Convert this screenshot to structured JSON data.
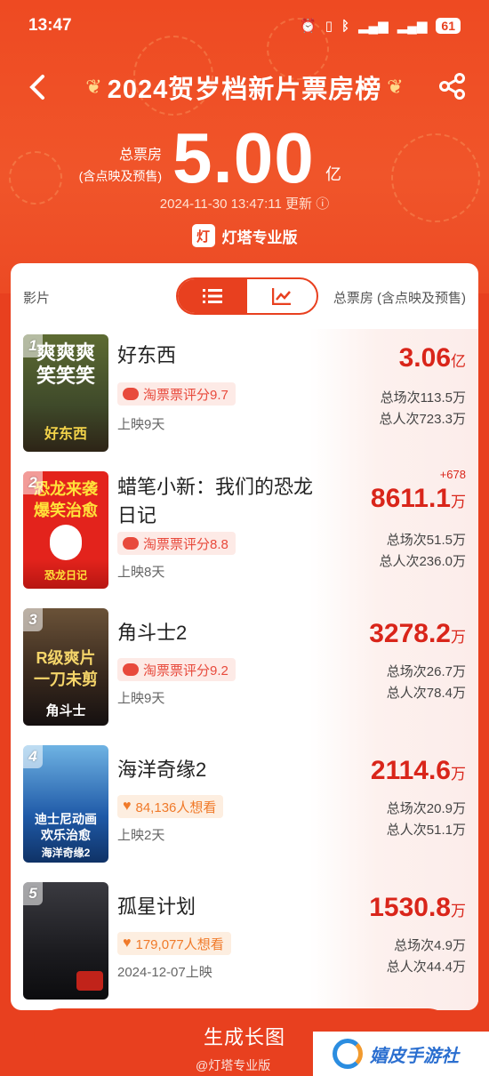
{
  "status": {
    "time": "13:47",
    "battery": "61"
  },
  "nav": {
    "title": "2024贺岁档新片票房榜"
  },
  "summary": {
    "label_line1": "总票房",
    "label_line2": "(含点映及预售)",
    "value": "5.00",
    "unit": "亿",
    "updated": "2024-11-30 13:47:11 更新 ⓘ"
  },
  "brand": {
    "logo_text": "灯",
    "label": "灯塔专业版"
  },
  "panel": {
    "col_film": "影片",
    "col_total": "总票房 (含点映及预售)",
    "view_active": "list-icon",
    "view_inactive": "chart-icon"
  },
  "films": [
    {
      "rank": "1",
      "name": "好东西",
      "badge": "淘票票评分9.7",
      "badge_type": "score",
      "release": "上映9天",
      "box": "3.06",
      "unit": "亿",
      "delta": "",
      "shows": "总场次113.5万",
      "viewers": "总人次723.3万",
      "poster_text": "爽 爽 爽\n笑 笑 笑",
      "poster_bg": "#3f4a2a"
    },
    {
      "rank": "2",
      "name": "蜡笔小新：我们的恐龙日记",
      "badge": "淘票票评分8.8",
      "badge_type": "score",
      "release": "上映8天",
      "box": "8611.1",
      "unit": "万",
      "delta": "+678",
      "shows": "总场次51.5万",
      "viewers": "总人次236.0万",
      "poster_text": "恐龙来袭\n爆笑治愈",
      "poster_bg": "#e3231c"
    },
    {
      "rank": "3",
      "name": "角斗士2",
      "badge": "淘票票评分9.2",
      "badge_type": "score",
      "release": "上映9天",
      "box": "3278.2",
      "unit": "万",
      "delta": "",
      "shows": "总场次26.7万",
      "viewers": "总人次78.4万",
      "poster_text": "R级爽片\n一刀未剪",
      "poster_bg": "#3a2a1e"
    },
    {
      "rank": "4",
      "name": "海洋奇缘2",
      "badge": "84,136人想看",
      "badge_type": "want",
      "release": "上映2天",
      "box": "2114.6",
      "unit": "万",
      "delta": "",
      "shows": "总场次20.9万",
      "viewers": "总人次51.1万",
      "poster_text": "迪士尼动画\n欢乐治愈",
      "poster_bg": "#1f5aa8"
    },
    {
      "rank": "5",
      "name": "孤星计划",
      "badge": "179,077人想看",
      "badge_type": "want",
      "release": "2024-12-07上映",
      "box": "1530.8",
      "unit": "万",
      "delta": "",
      "shows": "总场次4.9万",
      "viewers": "总人次44.4万",
      "poster_text": "",
      "poster_bg": "#1b1b1f"
    }
  ],
  "footer": {
    "button": "生成长图",
    "watermark": "@灯塔专业版",
    "corner_brand": "嬉皮手游社"
  },
  "colors": {
    "accent": "#e8401f",
    "value_red": "#d9251a"
  }
}
